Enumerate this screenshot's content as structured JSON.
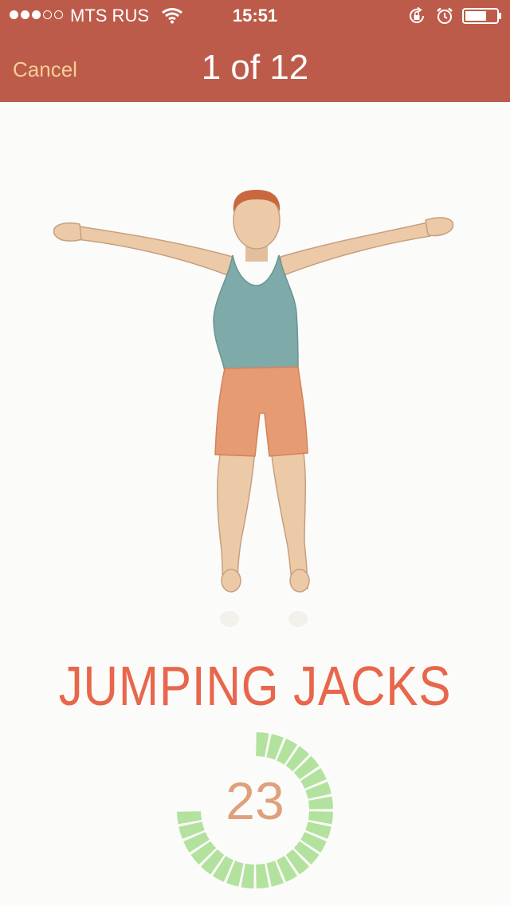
{
  "status_bar": {
    "carrier": "MTS RUS",
    "time": "15:51",
    "signal_bars": 3,
    "signal_max": 5
  },
  "nav": {
    "cancel_label": "Cancel",
    "title": "1 of 12"
  },
  "exercise": {
    "name": "JUMPING JACKS",
    "illustration": "man-standing-arms-out-illustration"
  },
  "timer": {
    "seconds_remaining": "23",
    "progress_fraction": 0.75,
    "segments_total": 32,
    "ring_color": "#b2e29d"
  },
  "colors": {
    "header": "#bd5b4a",
    "cancel": "#f4cf96",
    "exercise_name": "#e8664b",
    "countdown": "#dfa07c"
  },
  "icons": [
    "wifi-icon",
    "rotation-lock-icon",
    "alarm-icon",
    "battery-icon"
  ]
}
